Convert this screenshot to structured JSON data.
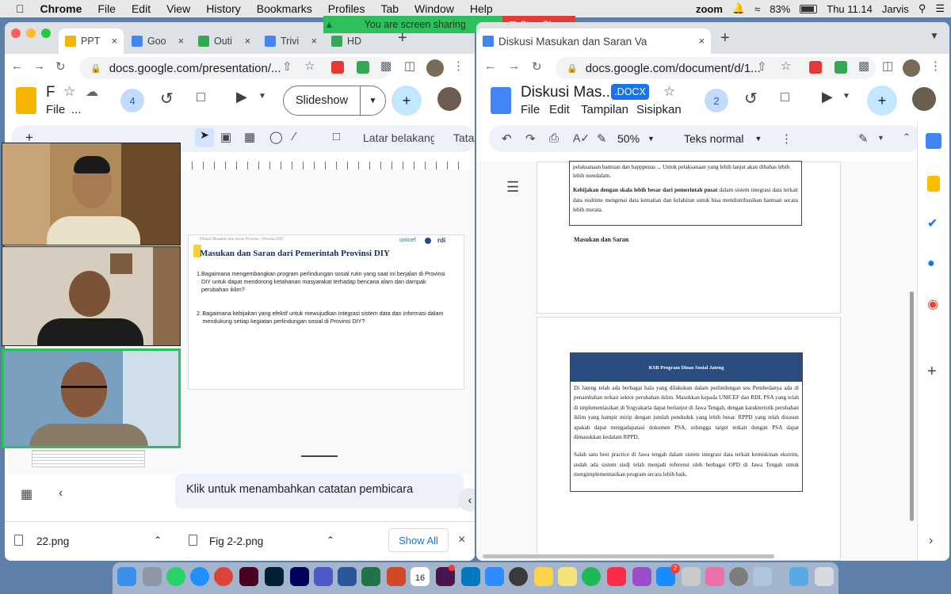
{
  "menubar": {
    "app": "Chrome",
    "items": [
      "File",
      "Edit",
      "View",
      "History",
      "Bookmarks",
      "Profiles",
      "Tab",
      "Window",
      "Help"
    ],
    "zoom_app": "zoom",
    "battery": "83%",
    "clock": "Thu 11.14",
    "user": "Jarvis"
  },
  "sharing": {
    "message": "You are screen sharing",
    "stop_label": "Stop Share"
  },
  "left_window": {
    "tabs": [
      "PPT",
      "Goo",
      "Outi",
      "Trivi",
      "HD"
    ],
    "url": "docs.google.com/presentation/...",
    "doc_title": "F",
    "menu_first": "File",
    "menu_dots": "...",
    "collab_count": "4",
    "slideshow_label": "Slideshow",
    "toolbar_items": {
      "background": "Latar belakang",
      "theme": "Tata"
    },
    "slide": {
      "header_small": "Diskusi Masukan dan Saran Provinsi - Provinsi DIY",
      "title": "Masukan dan Saran dari Pemerintah Provinsi DIY",
      "logos": [
        "unicef",
        "rdi"
      ],
      "items": [
        {
          "num": "1.",
          "text": "Bagaimana mengembangkan program perlindungan sosial rutin yang saat ini berjalan di Provinsi DIY untuk dapat mendorong ketahanan masyarakat terhadap bencana alam dan dampak perubahan iklim?"
        },
        {
          "num": "2.",
          "text": "Bagaimana kebijakan yang efektif untuk mewujudkan integrasi sistem data dan informasi dalam mendukung setiap kegiatan perlindungan sosial di Provinsi DIY?"
        }
      ]
    },
    "speaker_notes": "Klik untuk menambahkan catatan pembicara"
  },
  "downloads": {
    "files": [
      "22.png",
      "Fig 2-2.png"
    ],
    "show_all": "Show All"
  },
  "right_window": {
    "tab_title": "Diskusi Masukan dan Saran Va",
    "url": "docs.google.com/document/d/1...",
    "doc_title": "Diskusi Mas...",
    "format_badge": ".DOCX",
    "menus": [
      "File",
      "Edit",
      "Tampilan",
      "Sisipkan"
    ],
    "collab_count": "2",
    "zoom": "50%",
    "style": "Teks normal",
    "page1": {
      "line1": "pelaksanaan bantuan dan bapppenas ... Untuk pelaksanaan yang lebih lanjut akan dibahas lebih",
      "line2": "lebih mendalam.",
      "bold_lead": "Kebijakan dengan skala lebih besar dari pemerintah pusat",
      "para": " dalam sistem integrasi data terkait data realtime mengenai data kematian dan kelahiran untuk bisa mendistribusikan bantuan secara lebih merata.",
      "heading": "Masukan dan Saran"
    },
    "page2": {
      "table_header": "KSB Program Dinas Sosial Jateng",
      "para1": "Di Jateng telah ada berbagai hala yang dilakukan dalam perlindungan sos Pembedanya ada di penambahan terkait sektor perubahan iklim. Masukkan kepada UNICEF dan RDI, PSA yang telah di implementasikan di Yogyakarta dapat berlanjut di Jawa Tengah, dengan karakteristik perubahan iklim yang hampir mirip dengan jumlah penduduk yang lebih besar. RPPD yang telah disusun apakah dapat mengadapatasi dokumen PSA, sehingga target terkait dengan PSA dapat dimasukkan kedalam RPPD.",
      "para2": "Salah satu best practice di Jawa tengah dalam sistem integrasi data terkait kemiskinan ekstrim, sudah ada sistem sisdj telah menjadi referensi oleh berbagai OPD di Jawa Tengah untuk mengimplementasikan program secara lebih baik."
    }
  },
  "dock": {
    "calendar_day": "16",
    "mail_badge": "2"
  }
}
